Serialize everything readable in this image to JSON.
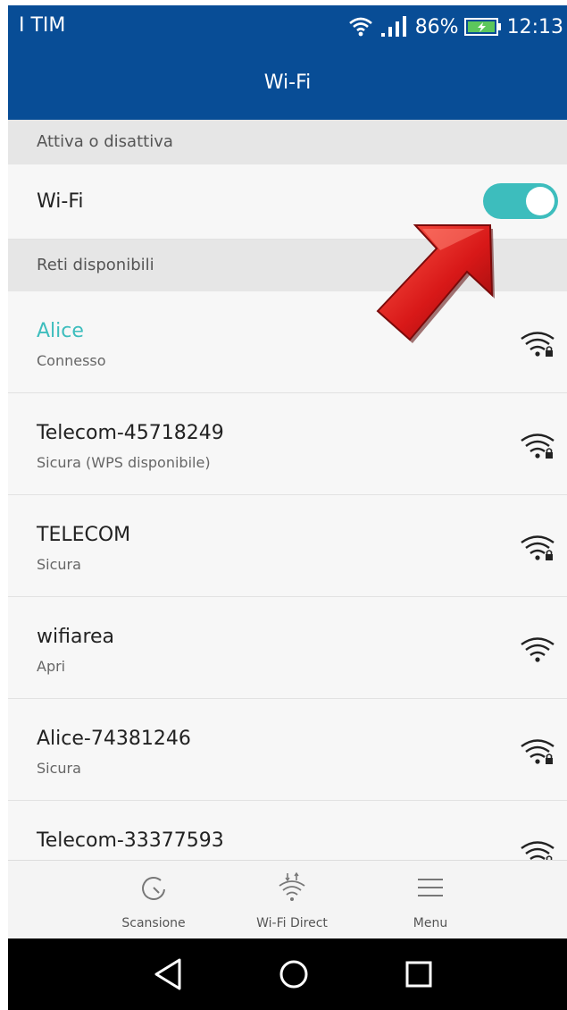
{
  "status_bar": {
    "carrier": "I TIM",
    "battery_percent": "86%",
    "time": "12:13",
    "icons": [
      "wifi-icon",
      "signal-bars-icon",
      "battery-icon"
    ]
  },
  "title_bar": {
    "title": "Wi-Fi"
  },
  "toggle_section": {
    "header": "Attiva o disattiva",
    "wifi_label": "Wi-Fi",
    "wifi_enabled": true
  },
  "networks_section": {
    "header": "Reti disponibili",
    "networks": [
      {
        "name": "Alice",
        "status": "Connesso",
        "connected": true,
        "secured": true
      },
      {
        "name": "Telecom-45718249",
        "status": "Sicura (WPS disponibile)",
        "connected": false,
        "secured": true
      },
      {
        "name": "TELECOM",
        "status": "Sicura",
        "connected": false,
        "secured": true
      },
      {
        "name": "wifiarea",
        "status": "Apri",
        "connected": false,
        "secured": false
      },
      {
        "name": "Alice-74381246",
        "status": "Sicura",
        "connected": false,
        "secured": true
      },
      {
        "name": "Telecom-33377593",
        "status": "",
        "connected": false,
        "secured": true
      }
    ]
  },
  "toolbar": {
    "scan_label": "Scansione",
    "direct_label": "Wi-Fi Direct",
    "menu_label": "Menu"
  },
  "nav_bar": {
    "icons": [
      "back-icon",
      "home-icon",
      "recent-apps-icon"
    ]
  },
  "colors": {
    "header_blue": "#084d96",
    "accent_teal": "#3dbdbd",
    "arrow_red": "#d81818"
  }
}
